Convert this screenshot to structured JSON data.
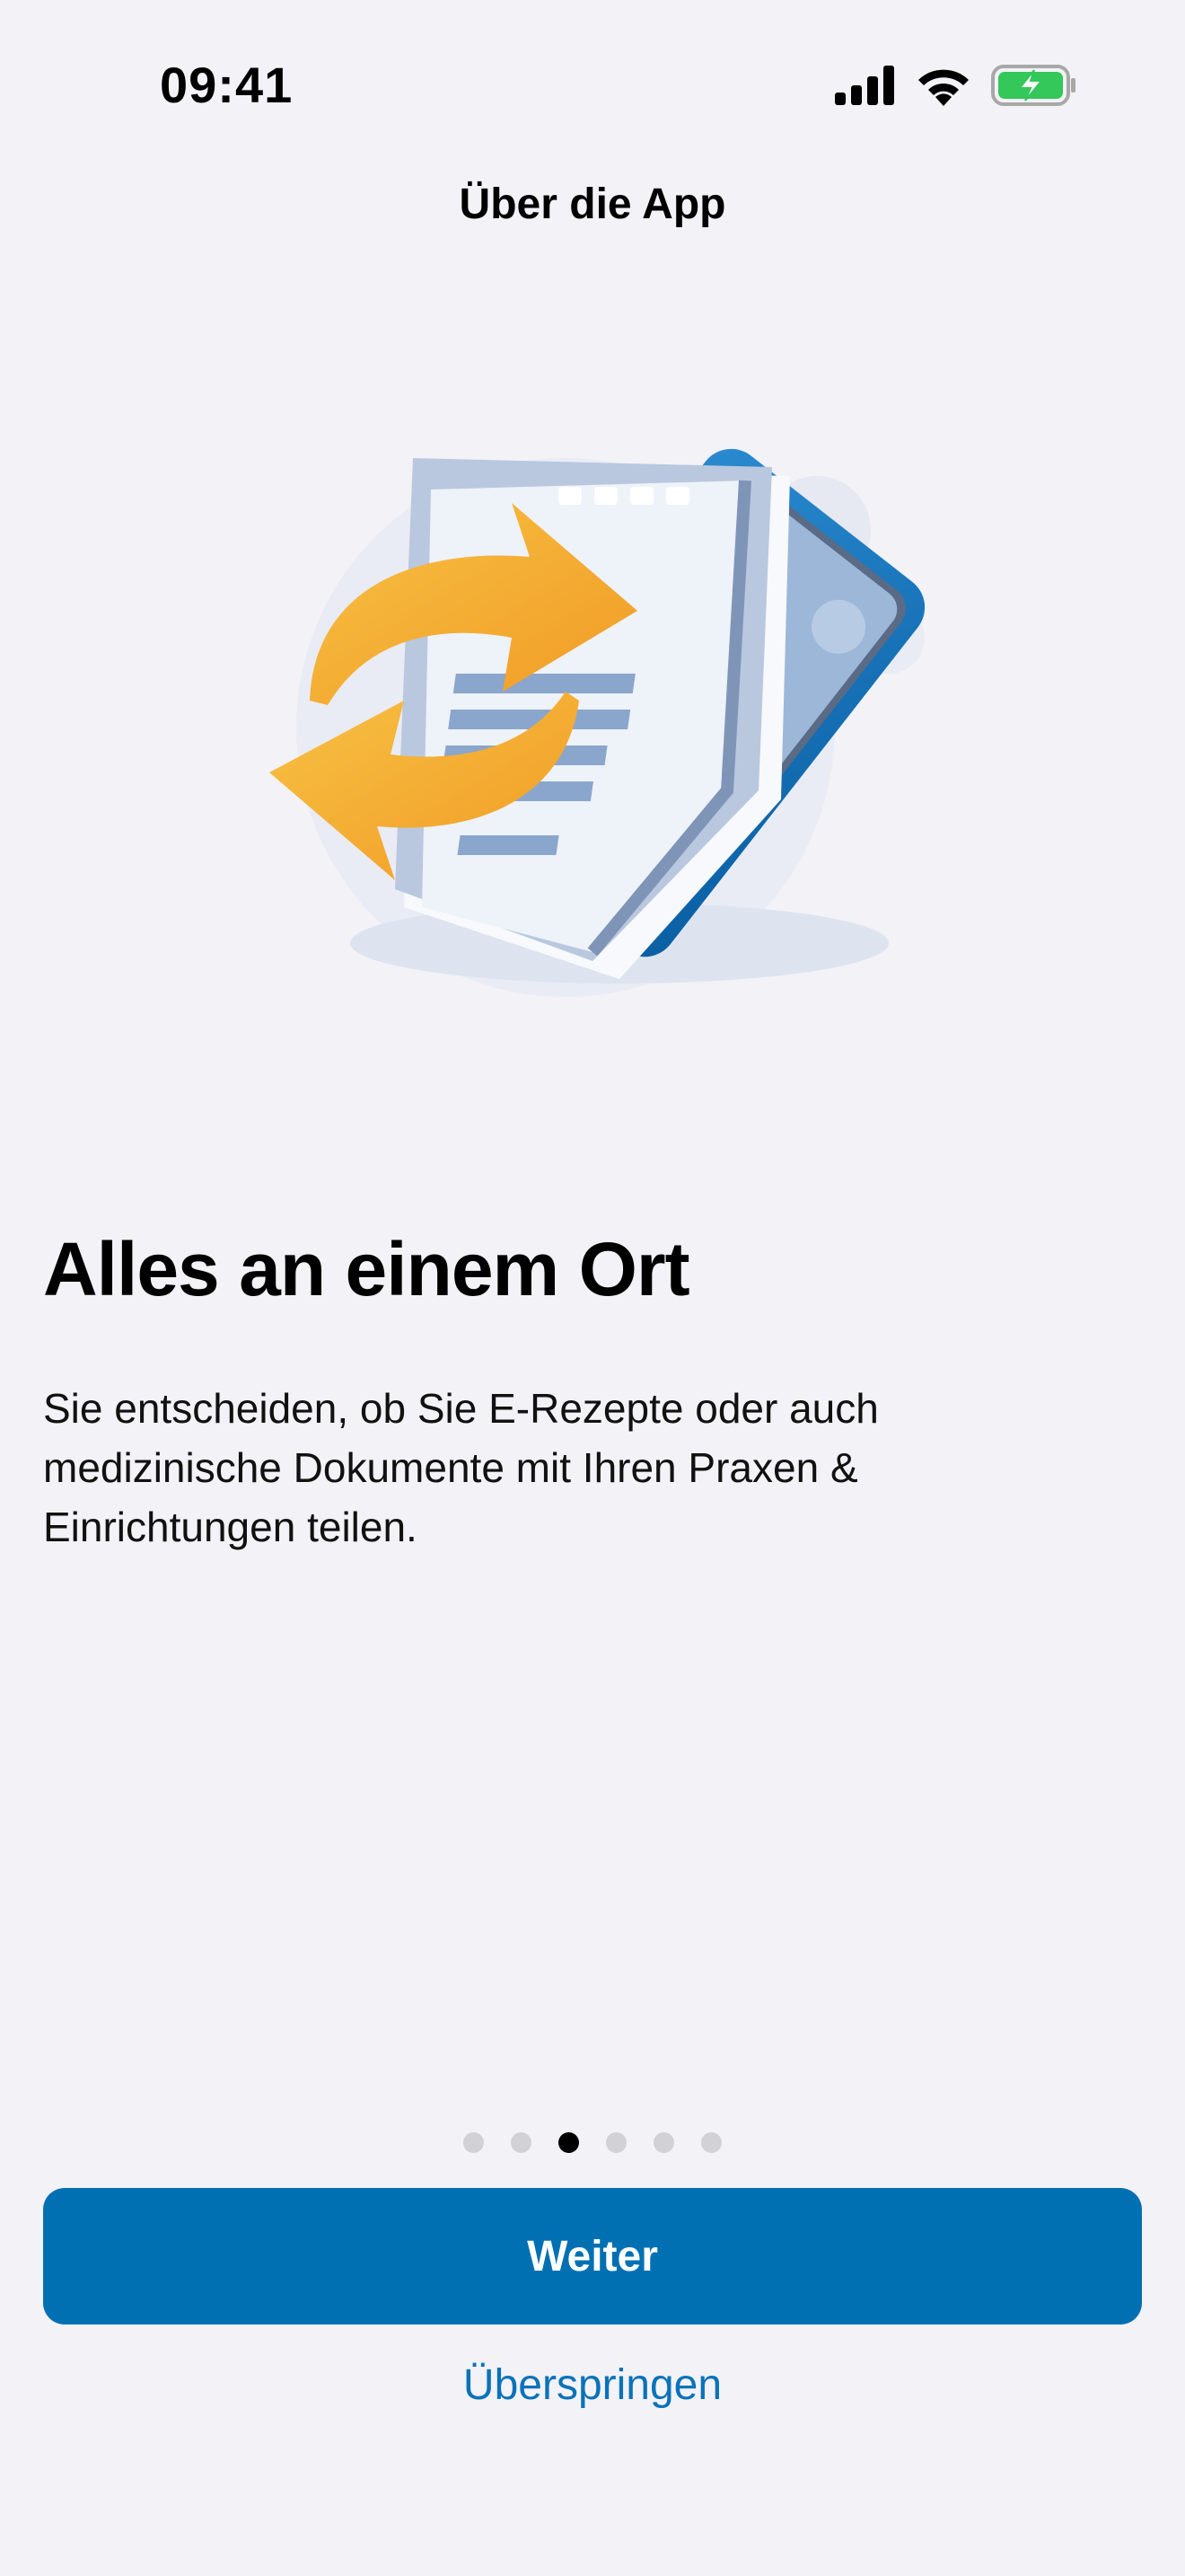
{
  "status_bar": {
    "time": "09:41"
  },
  "nav": {
    "title": "Über die App"
  },
  "content": {
    "headline": "Alles an einem Ort",
    "body": "Sie entscheiden, ob Sie E-Rezepte oder auch medizinische Dokumente mit Ihren Praxen & Einrichtungen teilen."
  },
  "pager": {
    "total": 6,
    "active_index": 2
  },
  "actions": {
    "primary_label": "Weiter",
    "skip_label": "Überspringen"
  },
  "colors": {
    "background": "#f2f2f7",
    "accent": "#0070b3",
    "link": "#0a72b8",
    "battery": "#34c759"
  },
  "icons": [
    "signal-icon",
    "wifi-icon",
    "battery-charging-icon",
    "document-sync-illustration"
  ]
}
